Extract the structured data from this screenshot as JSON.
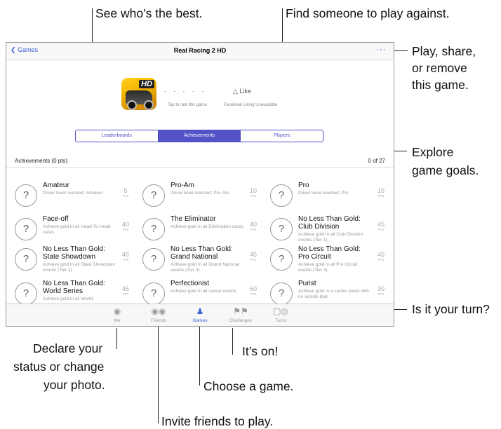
{
  "callouts": {
    "see_best": "See who’s the best.",
    "find_someone": "Find someone to play against.",
    "play_share_1": "Play, share,",
    "play_share_2": "or remove",
    "play_share_3": "this game.",
    "explore_1": "Explore",
    "explore_2": "game goals.",
    "your_turn": "Is it your turn?",
    "declare_1": "Declare your",
    "declare_2": "status or change",
    "declare_3": "your photo.",
    "its_on": "It’s on!",
    "choose_game": "Choose a game.",
    "invite": "Invite friends to play."
  },
  "navbar": {
    "back": "Games",
    "title": "Real Racing 2 HD",
    "more": "···"
  },
  "game": {
    "icon_badge": "HD",
    "stars": "· · · · ·",
    "stars_caption": "Tap to rate this game",
    "like": "Like",
    "like_caption": "Facebook Liking Unavailable"
  },
  "segments": [
    "Leaderboards",
    "Achievements",
    "Players"
  ],
  "achievements_header": "Achievements (0 pts)",
  "achievements_count": "0 of 27",
  "pts_unit": "PTS",
  "achievements": [
    {
      "title": "Amateur",
      "desc": "Driver level reached: Amateur",
      "pts": "5"
    },
    {
      "title": "Pro-Am",
      "desc": "Driver level reached: Pro-Am",
      "pts": "10"
    },
    {
      "title": "Pro",
      "desc": "Driver level reached: Pro",
      "pts": "15"
    },
    {
      "title": "Face-off",
      "desc": "Achieve gold in all Head-To-Head races",
      "pts": "40"
    },
    {
      "title": "The Eliminator",
      "desc": "Achieve gold in all Elimination races",
      "pts": "40"
    },
    {
      "title": "No Less Than Gold: Club Division",
      "desc": "Achieve gold in all Club Division events (Tier 1)",
      "pts": "45"
    },
    {
      "title": "No Less Than Gold: State Showdown",
      "desc": "Achieve gold in all State Showdown events (Tier 2)",
      "pts": "45"
    },
    {
      "title": "No Less Than Gold: Grand National",
      "desc": "Achieve gold in all Grand National events (Tier 3)",
      "pts": "45"
    },
    {
      "title": "No Less Than Gold: Pro Circuit",
      "desc": "Achieve gold in all Pro Circuit events (Tier 4)",
      "pts": "45"
    },
    {
      "title": "No Less Than Gold: World Series",
      "desc": "Achieve gold in all World",
      "pts": "45"
    },
    {
      "title": "Perfectionist",
      "desc": "Achieve gold in all career events",
      "pts": "60"
    },
    {
      "title": "Purist",
      "desc": "Achieve gold in a career event with no assists (bar",
      "pts": "30"
    }
  ],
  "tabs": [
    {
      "label": "Me",
      "icon": "avatar-icon"
    },
    {
      "label": "Friends",
      "icon": "friends-icon"
    },
    {
      "label": "Games",
      "icon": "games-icon",
      "active": true
    },
    {
      "label": "Challenges",
      "icon": "flags-icon"
    },
    {
      "label": "Turns",
      "icon": "turns-icon"
    }
  ],
  "colors": {
    "accent": "#5452c9",
    "link": "#3b62d6"
  }
}
